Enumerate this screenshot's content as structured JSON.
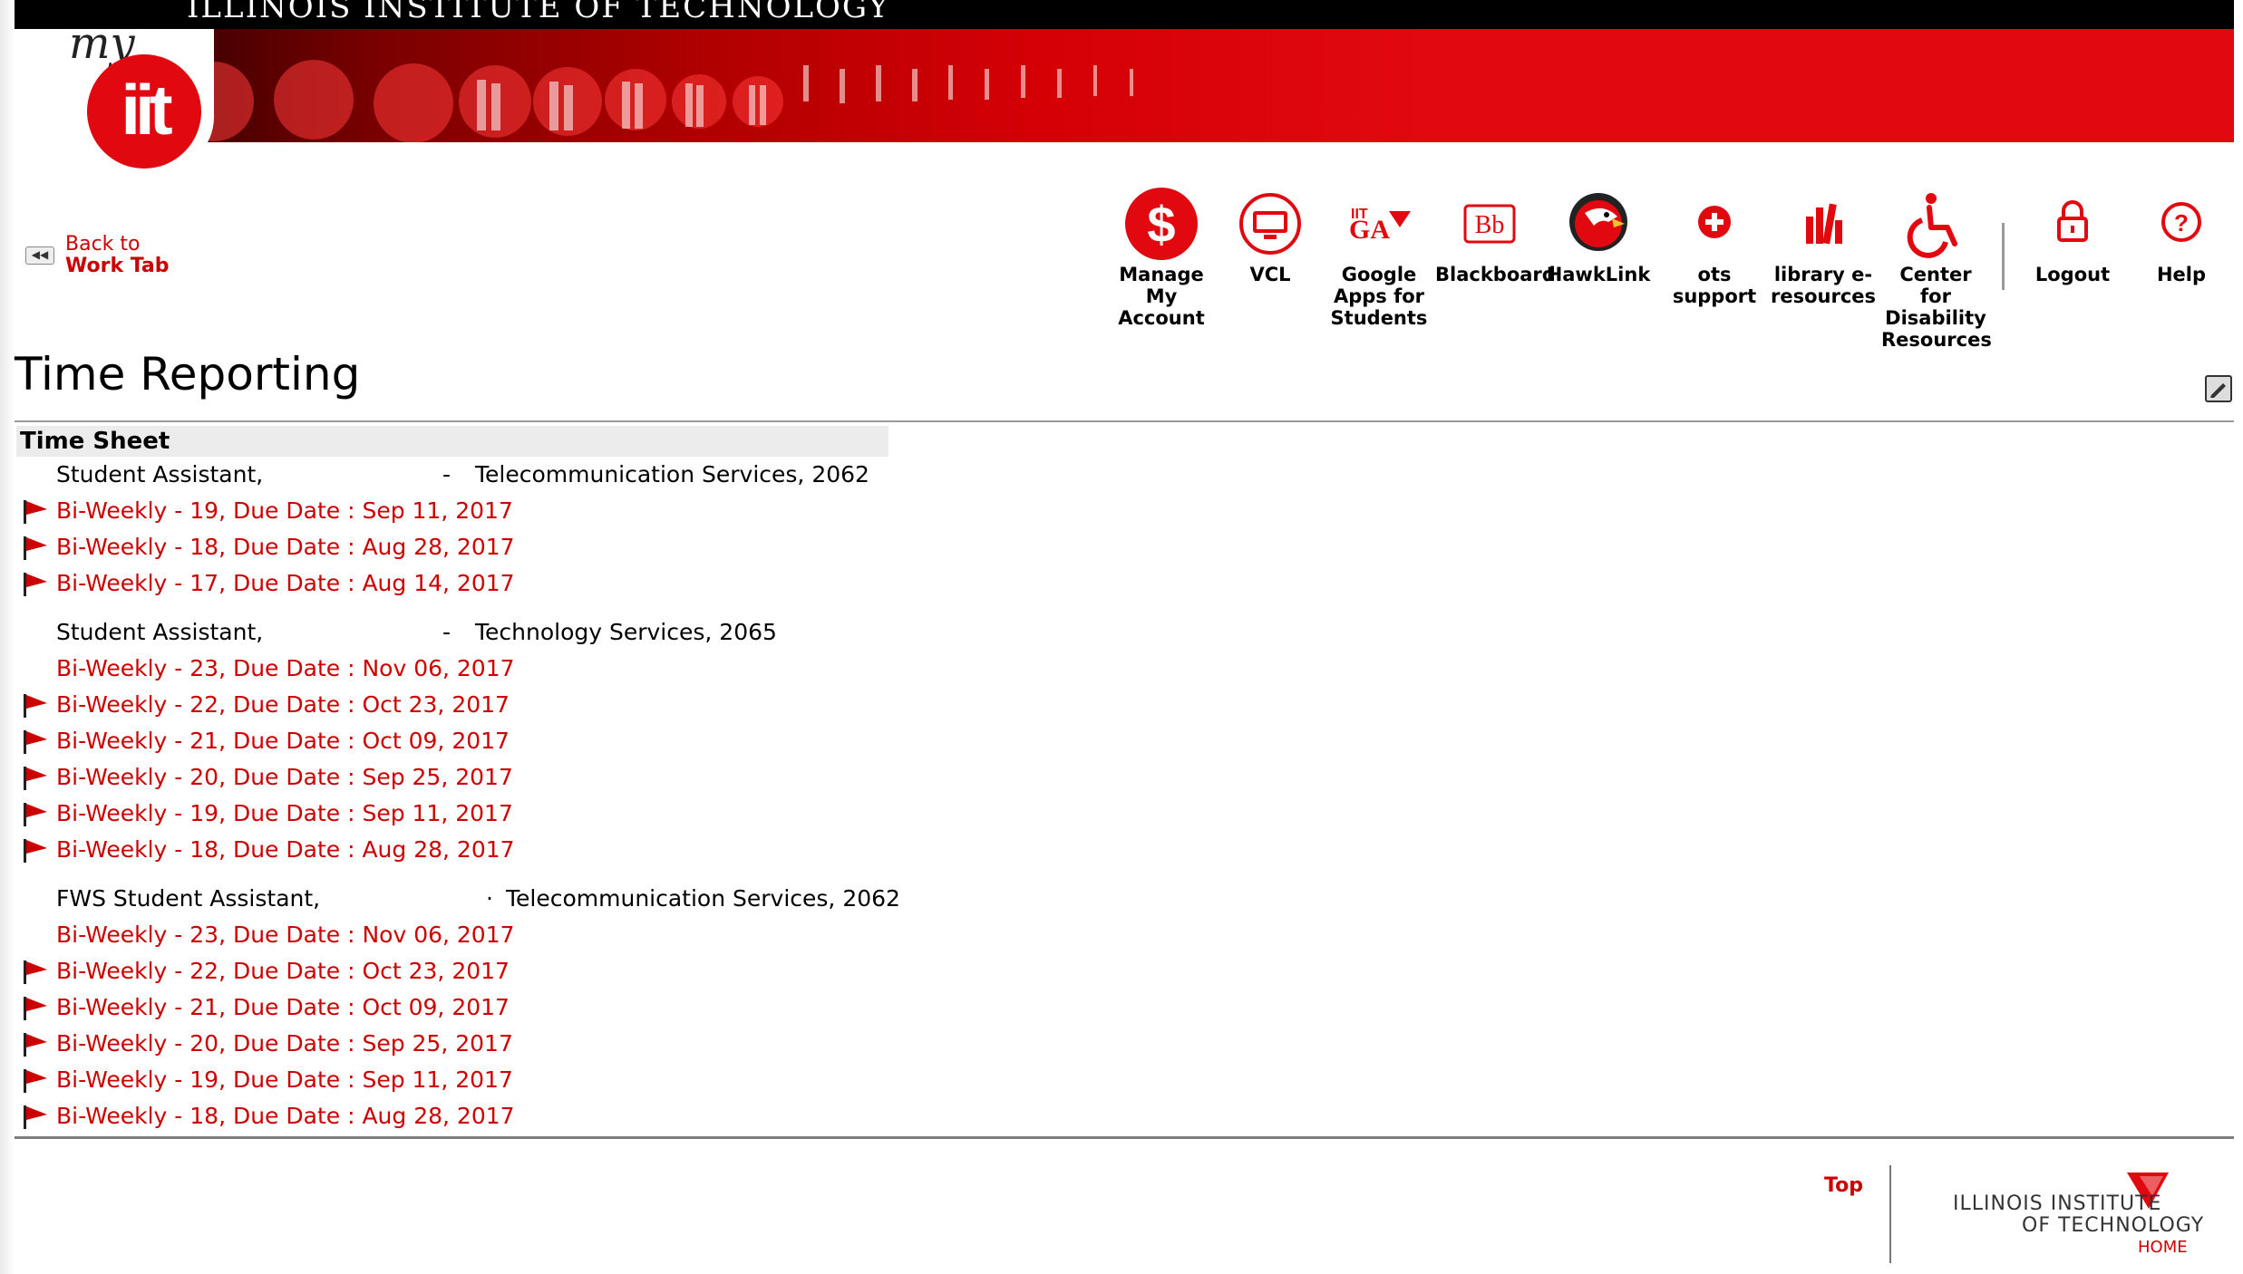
{
  "header": {
    "institution_banner": "ILLINOIS INSTITUTE OF TECHNOLOGY",
    "logo_my": "my",
    "logo_iit": "iit"
  },
  "back_link": {
    "line1": "Back to",
    "line2": "Work Tab"
  },
  "nav": [
    {
      "label": "Manage My Account",
      "icon": "dollar-icon"
    },
    {
      "label": "VCL",
      "icon": "monitor-icon"
    },
    {
      "label": "Google Apps for Students",
      "icon": "google-apps-icon"
    },
    {
      "label": "Blackboard",
      "icon": "blackboard-icon"
    },
    {
      "label": "HawkLink",
      "icon": "hawk-icon"
    },
    {
      "label": "ots support",
      "icon": "support-cross-icon"
    },
    {
      "label": "library e-resources",
      "icon": "library-icon"
    },
    {
      "label": "Center for Disability Resources",
      "icon": "accessibility-icon"
    },
    {
      "label": "Logout",
      "icon": "lock-icon"
    },
    {
      "label": "Help",
      "icon": "help-icon"
    }
  ],
  "page": {
    "title": "Time Reporting"
  },
  "timesheet": {
    "header": "Time Sheet",
    "jobs": [
      {
        "title": "Student Assistant,",
        "separator": "-",
        "department": "Telecommunication Services, 2062",
        "periods": [
          {
            "label": "Bi-Weekly - 19, Due Date : Sep 11, 2017",
            "flag": true
          },
          {
            "label": "Bi-Weekly - 18, Due Date : Aug 28, 2017",
            "flag": true
          },
          {
            "label": "Bi-Weekly - 17, Due Date : Aug 14, 2017",
            "flag": true
          }
        ]
      },
      {
        "title": "Student Assistant,",
        "separator": "-",
        "department": "Technology Services, 2065",
        "periods": [
          {
            "label": "Bi-Weekly - 23, Due Date : Nov 06, 2017",
            "flag": false
          },
          {
            "label": "Bi-Weekly - 22, Due Date : Oct 23, 2017",
            "flag": true
          },
          {
            "label": "Bi-Weekly - 21, Due Date : Oct 09, 2017",
            "flag": true
          },
          {
            "label": "Bi-Weekly - 20, Due Date : Sep 25, 2017",
            "flag": true
          },
          {
            "label": "Bi-Weekly - 19, Due Date : Sep 11, 2017",
            "flag": true
          },
          {
            "label": "Bi-Weekly - 18, Due Date : Aug 28, 2017",
            "flag": true
          }
        ]
      },
      {
        "title": "FWS Student Assistant,",
        "separator": "·",
        "department": "Telecommunication Services, 2062",
        "periods": [
          {
            "label": "Bi-Weekly - 23, Due Date : Nov 06, 2017",
            "flag": false
          },
          {
            "label": "Bi-Weekly - 22, Due Date : Oct 23, 2017",
            "flag": true
          },
          {
            "label": "Bi-Weekly - 21, Due Date : Oct 09, 2017",
            "flag": true
          },
          {
            "label": "Bi-Weekly - 20, Due Date : Sep 25, 2017",
            "flag": true
          },
          {
            "label": "Bi-Weekly - 19, Due Date : Sep 11, 2017",
            "flag": true
          },
          {
            "label": "Bi-Weekly - 18, Due Date : Aug 28, 2017",
            "flag": true
          }
        ]
      }
    ]
  },
  "footer": {
    "top_link": "Top",
    "logo_line1": "ILLINOIS INSTITUTE",
    "logo_line2": "OF TECHNOLOGY",
    "logo_home": "HOME"
  },
  "colors": {
    "brand_red": "#cc0000",
    "banner_red": "#e1090f"
  }
}
